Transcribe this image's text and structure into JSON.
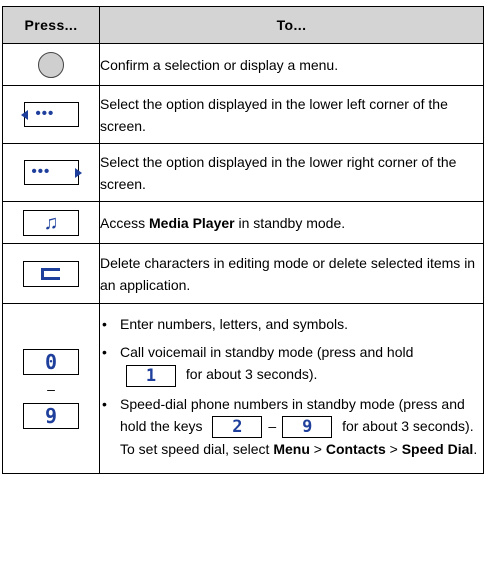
{
  "table": {
    "header_press": "Press...",
    "header_to": "To...",
    "rows": [
      {
        "key_icon": "center-select-key-icon",
        "text": "Confirm a selection or display a menu."
      },
      {
        "key_icon": "left-soft-key-icon",
        "key_label": "•••",
        "text": "Select the option displayed in the lower left corner of the screen."
      },
      {
        "key_icon": "right-soft-key-icon",
        "key_label": "•••",
        "text": "Select the option displayed in the lower right corner of the screen."
      },
      {
        "key_icon": "media-player-key-icon",
        "key_label": "♫",
        "text_pre": "Access ",
        "text_bold": "Media Player",
        "text_post": " in standby mode."
      },
      {
        "key_icon": "clear-key-icon",
        "text": "Delete characters in editing mode or delete selected items in an application."
      },
      {
        "key_icon": "number-keys-icon",
        "key_top": "0",
        "key_dash": "–",
        "key_bottom": "9",
        "bullet1": "Enter numbers, letters, and symbols.",
        "bullet2_pre": "Call voicemail in standby mode (press and hold",
        "bullet2_key": "1",
        "bullet2_post": "for about 3 seconds).",
        "bullet3_pre": "Speed-dial phone numbers in standby mode (press and hold the keys",
        "bullet3_key1": "2",
        "bullet3_dash": "–",
        "bullet3_key2": "9",
        "bullet3_mid": "for about 3 seconds). To set speed dial, select",
        "bullet3_menu": "Menu",
        "bullet3_sep1": " > ",
        "bullet3_contacts": "Contacts",
        "bullet3_sep2": " > ",
        "bullet3_speed": "Speed Dial",
        "bullet3_end": "."
      }
    ]
  },
  "colors": {
    "key_blue": "#1f3f9c",
    "header_bg": "#d4d4d4"
  }
}
